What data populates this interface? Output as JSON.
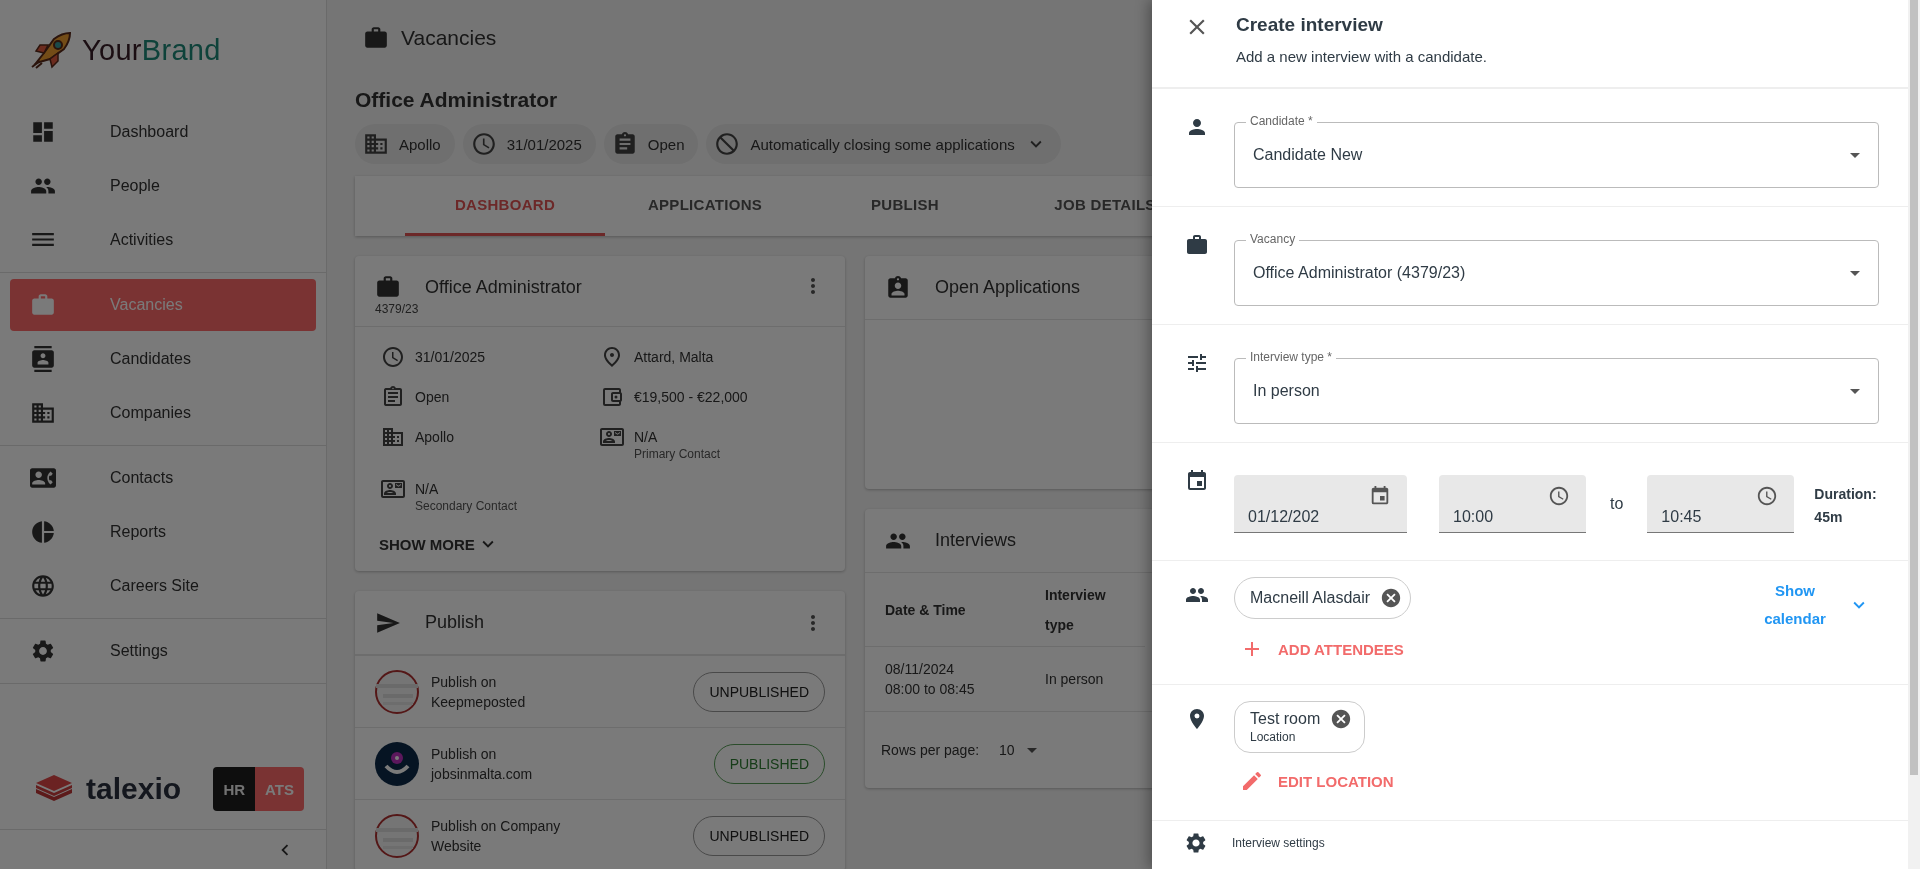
{
  "sidebar": {
    "brand": [
      "Your",
      "Brand"
    ],
    "groups": [
      [
        {
          "label": "Dashboard",
          "selected": false
        },
        {
          "label": "People",
          "selected": false
        },
        {
          "label": "Activities",
          "selected": false
        }
      ],
      [
        {
          "label": "Vacancies",
          "selected": true
        },
        {
          "label": "Candidates",
          "selected": false
        },
        {
          "label": "Companies",
          "selected": false
        }
      ],
      [
        {
          "label": "Contacts",
          "selected": false
        },
        {
          "label": "Reports",
          "selected": false
        },
        {
          "label": "Careers Site",
          "selected": false
        }
      ],
      [
        {
          "label": "Settings",
          "selected": false
        }
      ]
    ],
    "footer_logo": "talexio",
    "product_switch": [
      {
        "label": "HR",
        "selected": false
      },
      {
        "label": "ATS",
        "selected": true
      }
    ]
  },
  "header": {
    "title": "Vacancies"
  },
  "vacancy": {
    "title": "Office Administrator",
    "chips": [
      {
        "label": "Apollo"
      },
      {
        "label": "31/01/2025"
      },
      {
        "label": "Open"
      },
      {
        "label": "Automatically closing some applications",
        "dropdown": true
      }
    ],
    "tabs": [
      {
        "label": "DASHBOARD",
        "selected": true
      },
      {
        "label": "APPLICATIONS",
        "selected": false
      },
      {
        "label": "PUBLISH",
        "selected": false
      },
      {
        "label": "JOB DETAILS",
        "selected": false
      }
    ]
  },
  "details_card": {
    "title": "Office Administrator",
    "code": "4379/23",
    "items": [
      {
        "value": "31/01/2025"
      },
      {
        "value": "Attard, Malta"
      },
      {
        "value": "Open"
      },
      {
        "value": "€19,500 - €22,000"
      },
      {
        "value": "Apollo"
      },
      {
        "value": "N/A",
        "caption": "Primary Contact"
      },
      {
        "value": "N/A",
        "caption": "Secondary Contact"
      }
    ],
    "show_more": "SHOW MORE"
  },
  "publish_card": {
    "title": "Publish",
    "rows": [
      {
        "label": "Publish on Keepmeposted",
        "status": "UNPUBLISHED",
        "published": false
      },
      {
        "label": "Publish on jobsinmalta.com",
        "status": "PUBLISHED",
        "published": true
      },
      {
        "label": "Publish on Company Website",
        "status": "UNPUBLISHED",
        "published": false
      }
    ]
  },
  "applications_card": {
    "title": "Open Applications"
  },
  "interviews_card": {
    "title": "Interviews",
    "columns": [
      "Date & Time",
      "Interview type"
    ],
    "rows": [
      {
        "date": "08/11/2024",
        "time": "08:00 to 08:45",
        "type": "In person"
      }
    ],
    "rows_per_page_label": "Rows per page:",
    "rows_per_page": "10"
  },
  "drawer": {
    "title": "Create interview",
    "subtitle": "Add a new interview with a candidate.",
    "selects": [
      {
        "label": "Candidate *",
        "value": "Candidate New"
      },
      {
        "label": "Vacancy",
        "value": "Office Administrator (4379/23)"
      },
      {
        "label": "Interview type *",
        "value": "In person"
      }
    ],
    "date": "01/12/202",
    "start": "10:00",
    "separator": "to",
    "end": "10:45",
    "duration_label": "Duration:",
    "duration": "45m",
    "attendees": [
      {
        "name": "Macneill Alasdair"
      }
    ],
    "show_calendar": "Show calendar",
    "add_attendees": "ADD ATTENDEES",
    "location": {
      "name": "Test room",
      "caption": "Location"
    },
    "edit_location": "EDIT LOCATION",
    "next_section": "Interview settings"
  }
}
